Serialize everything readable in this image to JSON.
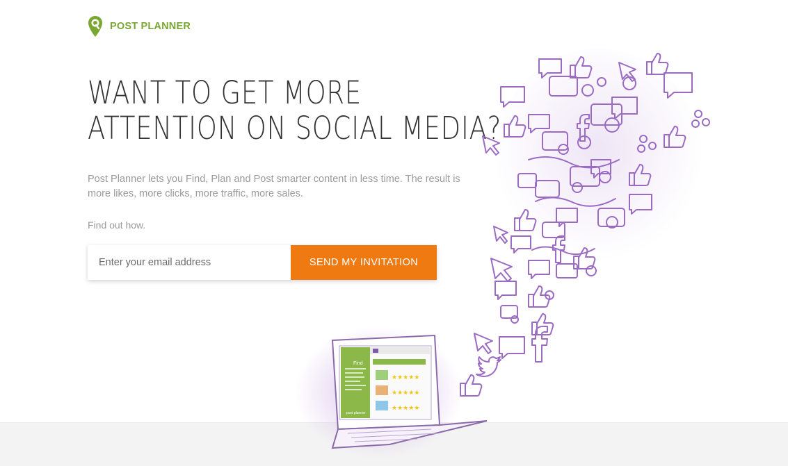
{
  "brand": {
    "name": "POST PLANNER",
    "color": "#7aa632"
  },
  "hero": {
    "headline_line1": "WANT TO GET MORE",
    "headline_line2": "ATTENTION ON SOCIAL MEDIA?",
    "description": "Post Planner lets you Find, Plan and Post smarter content in less time. The result is more likes, more clicks, more traffic, more sales.",
    "cta_text": "Find out how."
  },
  "signup": {
    "email_placeholder": "Enter your email address",
    "button_label": "SEND MY INVITATION",
    "button_color": "#f07a12"
  },
  "illustration": {
    "laptop_sidebar_label": "Find",
    "laptop_brand": "post planner",
    "accent_color": "#9b6bc4",
    "icons": [
      "thumbs-up-icon",
      "speech-bubble-icon",
      "facebook-f-icon",
      "twitter-bird-icon",
      "cursor-arrow-icon",
      "share-icon"
    ]
  }
}
